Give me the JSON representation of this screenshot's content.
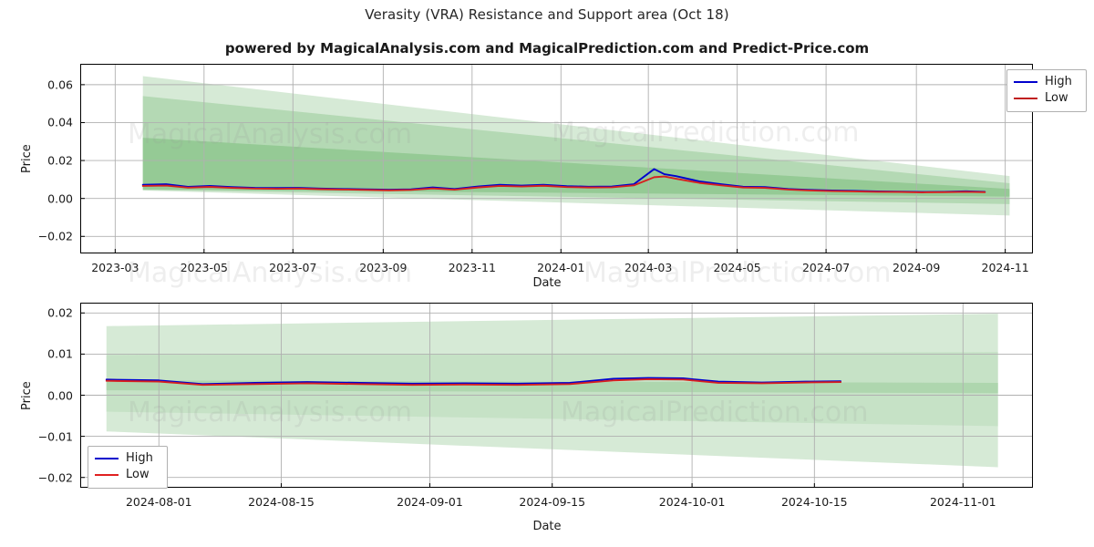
{
  "header": {
    "title": "Verasity (VRA) Resistance and Support area (Oct 18)",
    "subtitle": "powered by MagicalAnalysis.com and MagicalPrediction.com and Predict-Price.com"
  },
  "watermarks": {
    "analysis": "MagicalAnalysis.com",
    "prediction": "MagicalPrediction.com"
  },
  "legend": {
    "high": "High",
    "low": "Low"
  },
  "colors": {
    "high": "#0000cd",
    "low": "#d62020",
    "band_outer": "#cfe6cf",
    "band_mid": "#aed6ae",
    "band_inner": "#8fc78f",
    "grid": "#b0b0b0",
    "axis": "#000000",
    "watermark": "#9a9a9a"
  },
  "chart_data": [
    {
      "id": "upper",
      "type": "line",
      "title": "Verasity (VRA) Resistance and Support area (Oct 18)",
      "xlabel": "Date",
      "ylabel": "Price",
      "grid": true,
      "legend_position": "top-right",
      "ylim": [
        -0.029,
        0.071
      ],
      "yticks": [
        -0.02,
        0.0,
        0.02,
        0.04,
        0.06
      ],
      "ytick_labels": [
        "−0.02",
        "0.00",
        "0.02",
        "0.04",
        "0.06"
      ],
      "xlim": [
        "2023-02-05",
        "2024-11-20"
      ],
      "xticks": [
        "2023-03",
        "2023-05",
        "2023-07",
        "2023-09",
        "2023-11",
        "2024-01",
        "2024-03",
        "2024-05",
        "2024-07",
        "2024-09",
        "2024-11"
      ],
      "series": [
        {
          "name": "High",
          "color": "#0000cd",
          "x": [
            "2023-03-20",
            "2023-04-05",
            "2023-04-20",
            "2023-05-05",
            "2023-05-20",
            "2023-06-05",
            "2023-06-20",
            "2023-07-05",
            "2023-07-20",
            "2023-08-05",
            "2023-08-20",
            "2023-09-05",
            "2023-09-20",
            "2023-10-05",
            "2023-10-20",
            "2023-11-05",
            "2023-11-20",
            "2023-12-05",
            "2023-12-20",
            "2024-01-05",
            "2024-01-20",
            "2024-02-05",
            "2024-02-20",
            "2024-03-05",
            "2024-03-12",
            "2024-03-20",
            "2024-04-05",
            "2024-04-20",
            "2024-05-05",
            "2024-05-20",
            "2024-06-05",
            "2024-06-20",
            "2024-07-05",
            "2024-07-20",
            "2024-08-05",
            "2024-08-20",
            "2024-09-05",
            "2024-09-20",
            "2024-10-05",
            "2024-10-18"
          ],
          "y": [
            0.0072,
            0.0075,
            0.0061,
            0.0066,
            0.006,
            0.0056,
            0.0055,
            0.0056,
            0.0052,
            0.005,
            0.0048,
            0.0046,
            0.0048,
            0.0058,
            0.005,
            0.0063,
            0.0072,
            0.0068,
            0.0072,
            0.0065,
            0.0062,
            0.0063,
            0.0075,
            0.0155,
            0.0128,
            0.0118,
            0.009,
            0.0075,
            0.0062,
            0.006,
            0.005,
            0.0045,
            0.0042,
            0.004,
            0.0037,
            0.0036,
            0.0034,
            0.0035,
            0.0038,
            0.0035
          ]
        },
        {
          "name": "Low",
          "color": "#d62020",
          "x": [
            "2023-03-20",
            "2023-04-05",
            "2023-04-20",
            "2023-05-05",
            "2023-05-20",
            "2023-06-05",
            "2023-06-20",
            "2023-07-05",
            "2023-07-20",
            "2023-08-05",
            "2023-08-20",
            "2023-09-05",
            "2023-09-20",
            "2023-10-05",
            "2023-10-20",
            "2023-11-05",
            "2023-11-20",
            "2023-12-05",
            "2023-12-20",
            "2024-01-05",
            "2024-01-20",
            "2024-02-05",
            "2024-02-20",
            "2024-03-05",
            "2024-03-12",
            "2024-03-20",
            "2024-04-05",
            "2024-04-20",
            "2024-05-05",
            "2024-05-20",
            "2024-06-05",
            "2024-06-20",
            "2024-07-05",
            "2024-07-20",
            "2024-08-05",
            "2024-08-20",
            "2024-09-05",
            "2024-09-20",
            "2024-10-05",
            "2024-10-18"
          ],
          "y": [
            0.0066,
            0.0068,
            0.0057,
            0.0061,
            0.0056,
            0.0052,
            0.0051,
            0.0052,
            0.0049,
            0.0047,
            0.0045,
            0.0043,
            0.0045,
            0.0053,
            0.0046,
            0.0058,
            0.0066,
            0.0063,
            0.0067,
            0.006,
            0.0058,
            0.0059,
            0.0069,
            0.0112,
            0.0116,
            0.0104,
            0.0082,
            0.0069,
            0.0058,
            0.0056,
            0.0047,
            0.0042,
            0.0039,
            0.0037,
            0.0035,
            0.0034,
            0.0032,
            0.0033,
            0.0035,
            0.0033
          ]
        }
      ],
      "bands": [
        {
          "name": "outer",
          "color": "#cfe6cf",
          "x_start": "2023-03-20",
          "x_end": "2024-11-04",
          "y_start_top": 0.0645,
          "y_start_bottom": 0.0042,
          "y_end_top": 0.0118,
          "y_end_bottom": -0.009
        },
        {
          "name": "mid",
          "color": "#aed6ae",
          "x_start": "2023-03-20",
          "x_end": "2024-11-04",
          "y_start_top": 0.054,
          "y_start_bottom": 0.0045,
          "y_end_top": 0.008,
          "y_end_bottom": -0.003
        },
        {
          "name": "inner",
          "color": "#8fc78f",
          "x_start": "2023-03-20",
          "x_end": "2024-11-04",
          "y_start_top": 0.032,
          "y_start_bottom": 0.0048,
          "y_end_top": 0.005,
          "y_end_bottom": 0.001
        }
      ]
    },
    {
      "id": "lower",
      "type": "line",
      "xlabel": "Date",
      "ylabel": "Price",
      "grid": true,
      "legend_position": "bottom-left",
      "ylim": [
        -0.0225,
        0.0225
      ],
      "yticks": [
        -0.02,
        -0.01,
        0.0,
        0.01,
        0.02
      ],
      "ytick_labels": [
        "−0.02",
        "−0.01",
        "0.00",
        "0.01",
        "0.02"
      ],
      "xlim": [
        "2024-07-23",
        "2024-11-09"
      ],
      "xticks": [
        "2024-08-01",
        "2024-08-15",
        "2024-09-01",
        "2024-09-15",
        "2024-10-01",
        "2024-10-15",
        "2024-11-01"
      ],
      "series": [
        {
          "name": "High",
          "color": "#0000cd",
          "x": [
            "2024-07-26",
            "2024-08-01",
            "2024-08-06",
            "2024-08-12",
            "2024-08-18",
            "2024-08-24",
            "2024-08-30",
            "2024-09-05",
            "2024-09-11",
            "2024-09-17",
            "2024-09-22",
            "2024-09-26",
            "2024-09-30",
            "2024-10-04",
            "2024-10-09",
            "2024-10-14",
            "2024-10-18"
          ],
          "y": [
            0.0038,
            0.0036,
            0.0027,
            0.003,
            0.0032,
            0.003,
            0.0028,
            0.0029,
            0.0028,
            0.003,
            0.004,
            0.0042,
            0.0041,
            0.0033,
            0.0031,
            0.0033,
            0.0034
          ]
        },
        {
          "name": "Low",
          "color": "#d62020",
          "x": [
            "2024-07-26",
            "2024-08-01",
            "2024-08-06",
            "2024-08-12",
            "2024-08-18",
            "2024-08-24",
            "2024-08-30",
            "2024-09-05",
            "2024-09-11",
            "2024-09-17",
            "2024-09-22",
            "2024-09-26",
            "2024-09-30",
            "2024-10-04",
            "2024-10-09",
            "2024-10-14",
            "2024-10-18"
          ],
          "y": [
            0.0035,
            0.0033,
            0.0025,
            0.0027,
            0.0029,
            0.0027,
            0.0025,
            0.0026,
            0.0025,
            0.0027,
            0.0036,
            0.0039,
            0.0038,
            0.003,
            0.0029,
            0.0031,
            0.0032
          ]
        }
      ],
      "bands": [
        {
          "name": "outer",
          "color": "#cfe6cf",
          "x_start": "2024-07-26",
          "x_end": "2024-11-05",
          "y_start_top": 0.0168,
          "y_start_bottom": -0.0088,
          "y_end_top": 0.0198,
          "y_end_bottom": -0.0175
        },
        {
          "name": "mid",
          "color": "#c3e0c3",
          "x_start": "2024-07-26",
          "x_end": "2024-11-05",
          "y_start_top": 0.0098,
          "y_start_bottom": -0.004,
          "y_end_top": 0.0105,
          "y_end_bottom": -0.0075
        },
        {
          "name": "inner",
          "color": "#a9d4a9",
          "x_start": "2024-07-26",
          "x_end": "2024-11-05",
          "y_start_top": 0.0036,
          "y_start_bottom": 0.0012,
          "y_end_top": 0.003,
          "y_end_bottom": 0.0005
        }
      ]
    }
  ]
}
